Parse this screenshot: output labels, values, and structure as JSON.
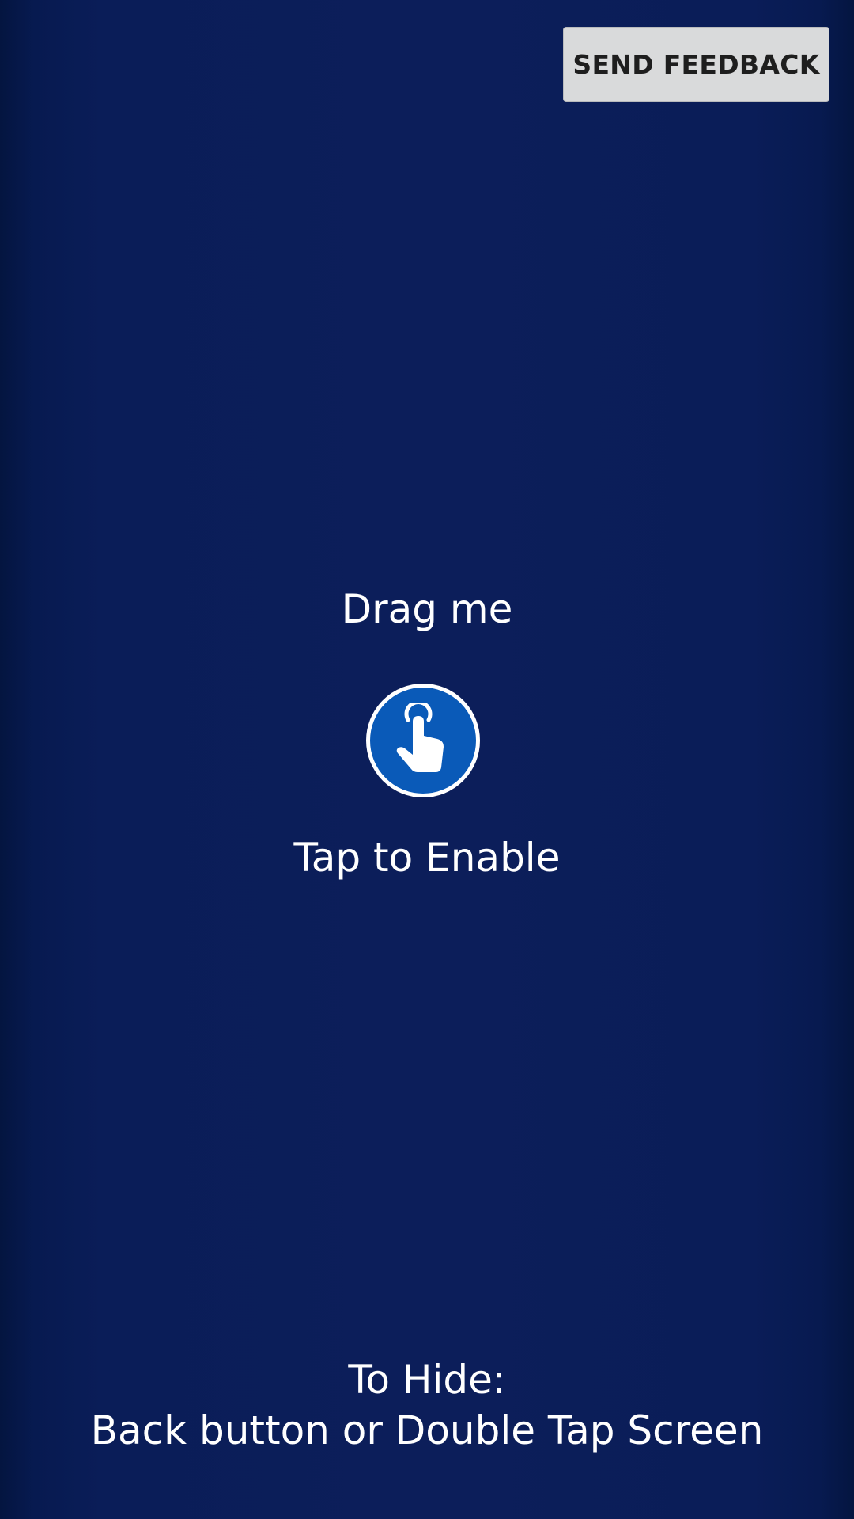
{
  "header": {
    "feedback_label": "SEND FEEDBACK"
  },
  "main": {
    "drag_label": "Drag me",
    "handle_icon": "tap-hand-icon",
    "tap_label": "Tap to Enable"
  },
  "footer": {
    "hide_title": "To Hide:",
    "hide_instructions": "Back button or Double Tap Screen"
  },
  "colors": {
    "background": "#0c1e5a",
    "handle_fill": "#0a5ab8",
    "button_bg": "#d9dadb",
    "text": "#ffffff"
  }
}
